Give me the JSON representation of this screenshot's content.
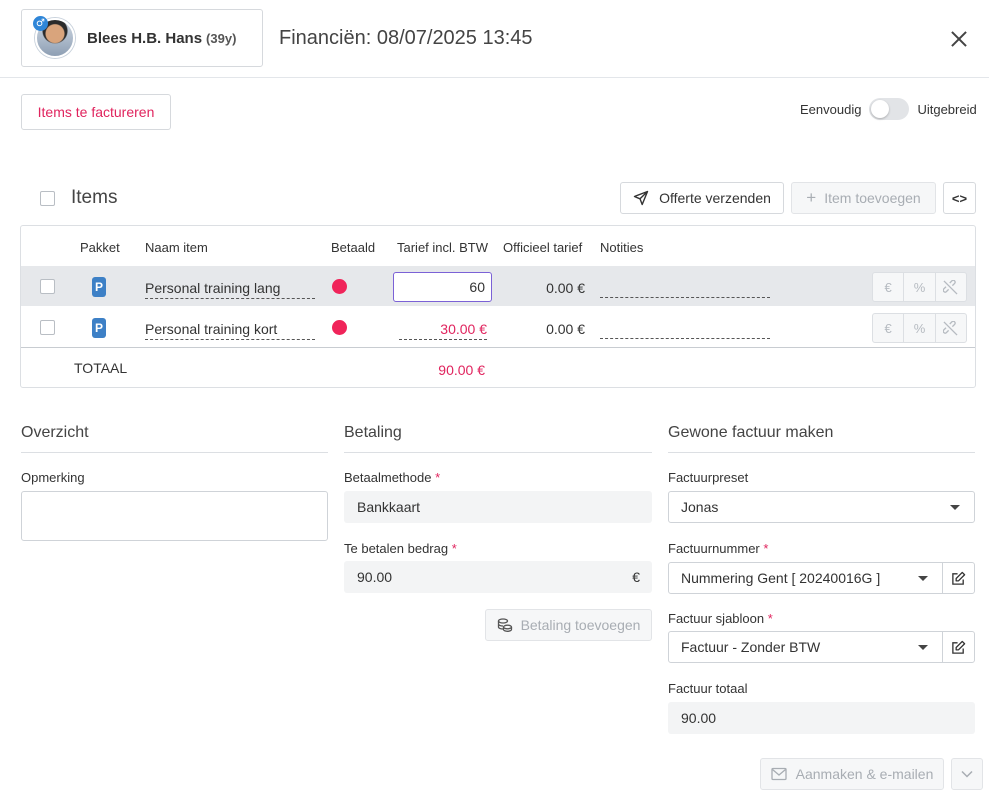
{
  "header": {
    "patient_name": "Blees H.B. Hans",
    "patient_age": "(39y)",
    "gender_symbol": "♂",
    "title": "Financiën: 08/07/2025 13:45"
  },
  "toolbar": {
    "items_to_invoice": "Items te factureren",
    "mode_simple": "Eenvoudig",
    "mode_extended": "Uitgebreid"
  },
  "items": {
    "title": "Items",
    "send_quote": "Offerte verzenden",
    "add_item": "Item toevoegen",
    "code_toggle": "<>",
    "columns": [
      "Pakket",
      "Naam item",
      "Betaald",
      "Tarief incl. BTW",
      "Officieel tarief",
      "Notities"
    ],
    "rows": [
      {
        "package": "P",
        "name": "Personal training lang",
        "paid_color": "#f0245a",
        "price": "60",
        "official": "0.00 €"
      },
      {
        "package": "P",
        "name": "Personal training kort",
        "paid_color": "#f0245a",
        "price": "30.00 €",
        "official": "0.00 €"
      }
    ],
    "total_label": "TOTAAL",
    "total_value": "90.00 €",
    "row_actions": [
      "€",
      "%",
      "unlink-icon"
    ]
  },
  "overview": {
    "title": "Overzicht",
    "remark_label": "Opmerking",
    "remark_value": ""
  },
  "payment": {
    "title": "Betaling",
    "method_label": "Betaalmethode",
    "method_value": "Bankkaart",
    "amount_label": "Te betalen bedrag",
    "amount_value": "90.00",
    "currency": "€",
    "add_payment": "Betaling toevoegen",
    "required_mark": "*"
  },
  "invoice": {
    "title": "Gewone factuur maken",
    "preset_label": "Factuurpreset",
    "preset_value": "Jonas",
    "number_label": "Factuurnummer",
    "number_value": "Nummering Gent [ 20240016G ]",
    "template_label": "Factuur sjabloon",
    "template_value": "Factuur - Zonder BTW",
    "total_label": "Factuur totaal",
    "total_value": "90.00",
    "create_email": "Aanmaken & e-mailen"
  },
  "colors": {
    "accent": "#e0245e",
    "package_badge": "#3d80c6",
    "active_input": "#7b61d6"
  }
}
